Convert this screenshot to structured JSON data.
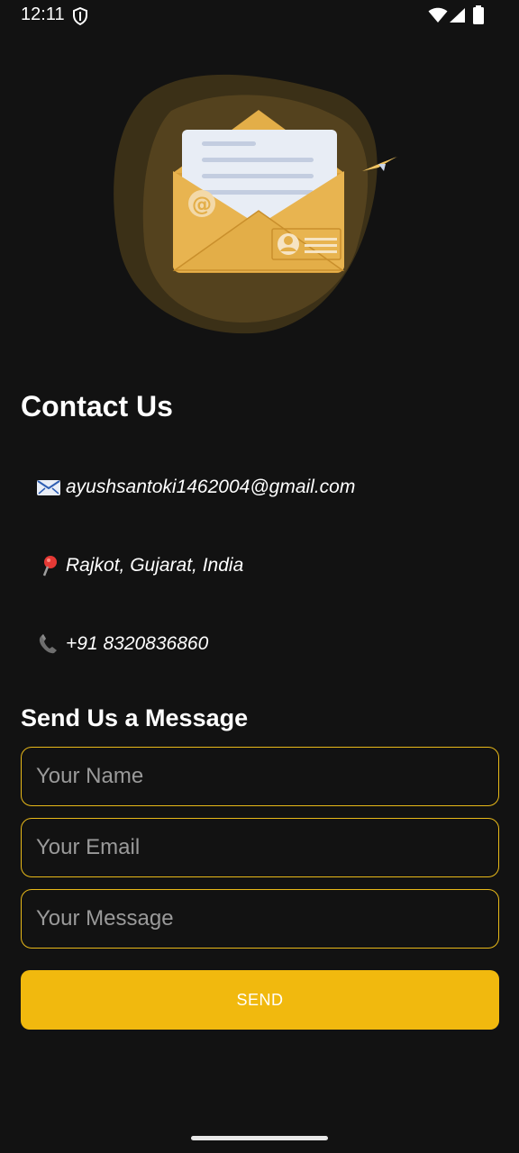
{
  "status_bar": {
    "time": "12:11",
    "icons": [
      "shield-icon",
      "wifi-icon",
      "signal-icon",
      "battery-icon"
    ]
  },
  "hero": {
    "icon": "envelope-illustration",
    "colors": {
      "blob": "#4a3a1c",
      "envelope": "#e3ae48",
      "letter": "#e8edf5"
    }
  },
  "contact": {
    "title": "Contact Us",
    "email": {
      "icon": "envelope-emoji-icon",
      "text": "ayushsantoki1462004@gmail.com"
    },
    "location": {
      "icon": "pin-emoji-icon",
      "text": "Rajkot, Gujarat, India"
    },
    "phone": {
      "icon": "phone-emoji-icon",
      "text": "+91 8320836860"
    }
  },
  "form": {
    "title": "Send Us a Message",
    "name_placeholder": "Your Name",
    "email_placeholder": "Your Email",
    "message_placeholder": "Your Message",
    "send_label": "SEND",
    "accent_color": "#f1b90e"
  }
}
